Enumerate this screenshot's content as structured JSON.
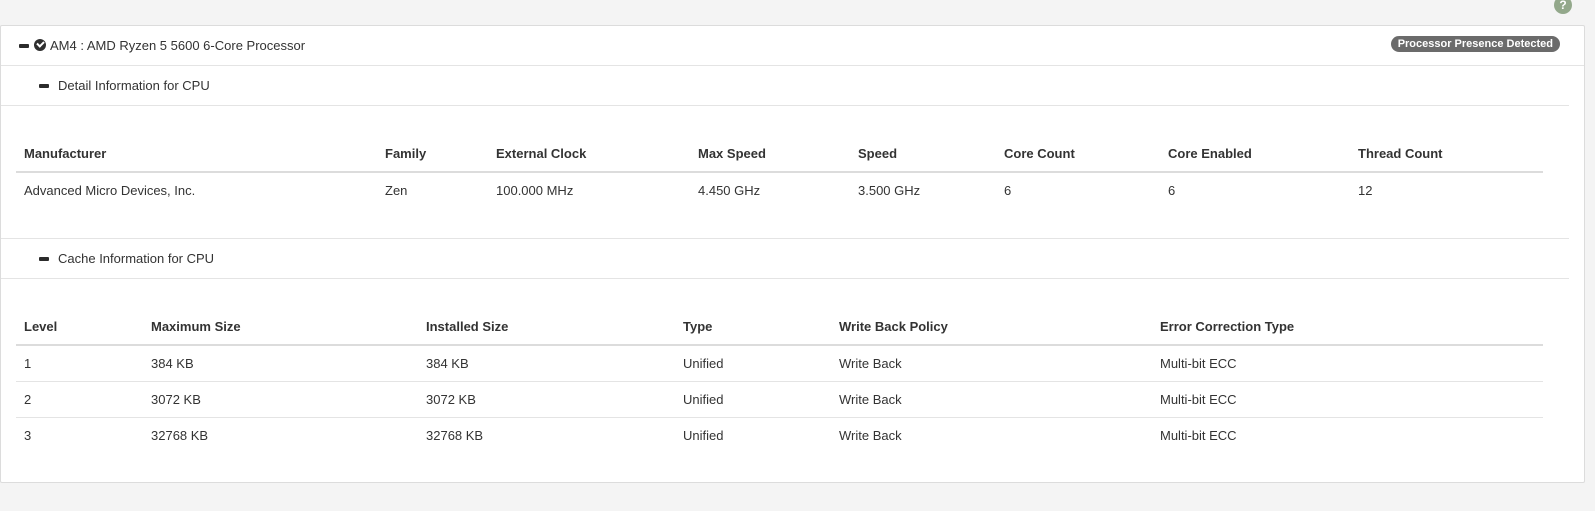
{
  "help_icon": "?",
  "processor": {
    "title": "AM4 : AMD Ryzen 5 5600 6-Core Processor",
    "badge": "Processor Presence Detected"
  },
  "detail_section": {
    "title": "Detail Information for CPU",
    "headers": [
      "Manufacturer",
      "Family",
      "External Clock",
      "Max Speed",
      "Speed",
      "Core Count",
      "Core Enabled",
      "Thread Count"
    ],
    "row": [
      "Advanced Micro Devices, Inc.",
      "Zen",
      "100.000 MHz",
      "4.450 GHz",
      "3.500 GHz",
      "6",
      "6",
      "12"
    ]
  },
  "cache_section": {
    "title": "Cache Information for CPU",
    "headers": [
      "Level",
      "Maximum Size",
      "Installed Size",
      "Type",
      "Write Back Policy",
      "Error Correction Type"
    ],
    "rows": [
      [
        "1",
        "384 KB",
        "384 KB",
        "Unified",
        "Write Back",
        "Multi-bit ECC"
      ],
      [
        "2",
        "3072 KB",
        "3072 KB",
        "Unified",
        "Write Back",
        "Multi-bit ECC"
      ],
      [
        "3",
        "32768 KB",
        "32768 KB",
        "Unified",
        "Write Back",
        "Multi-bit ECC"
      ]
    ]
  }
}
